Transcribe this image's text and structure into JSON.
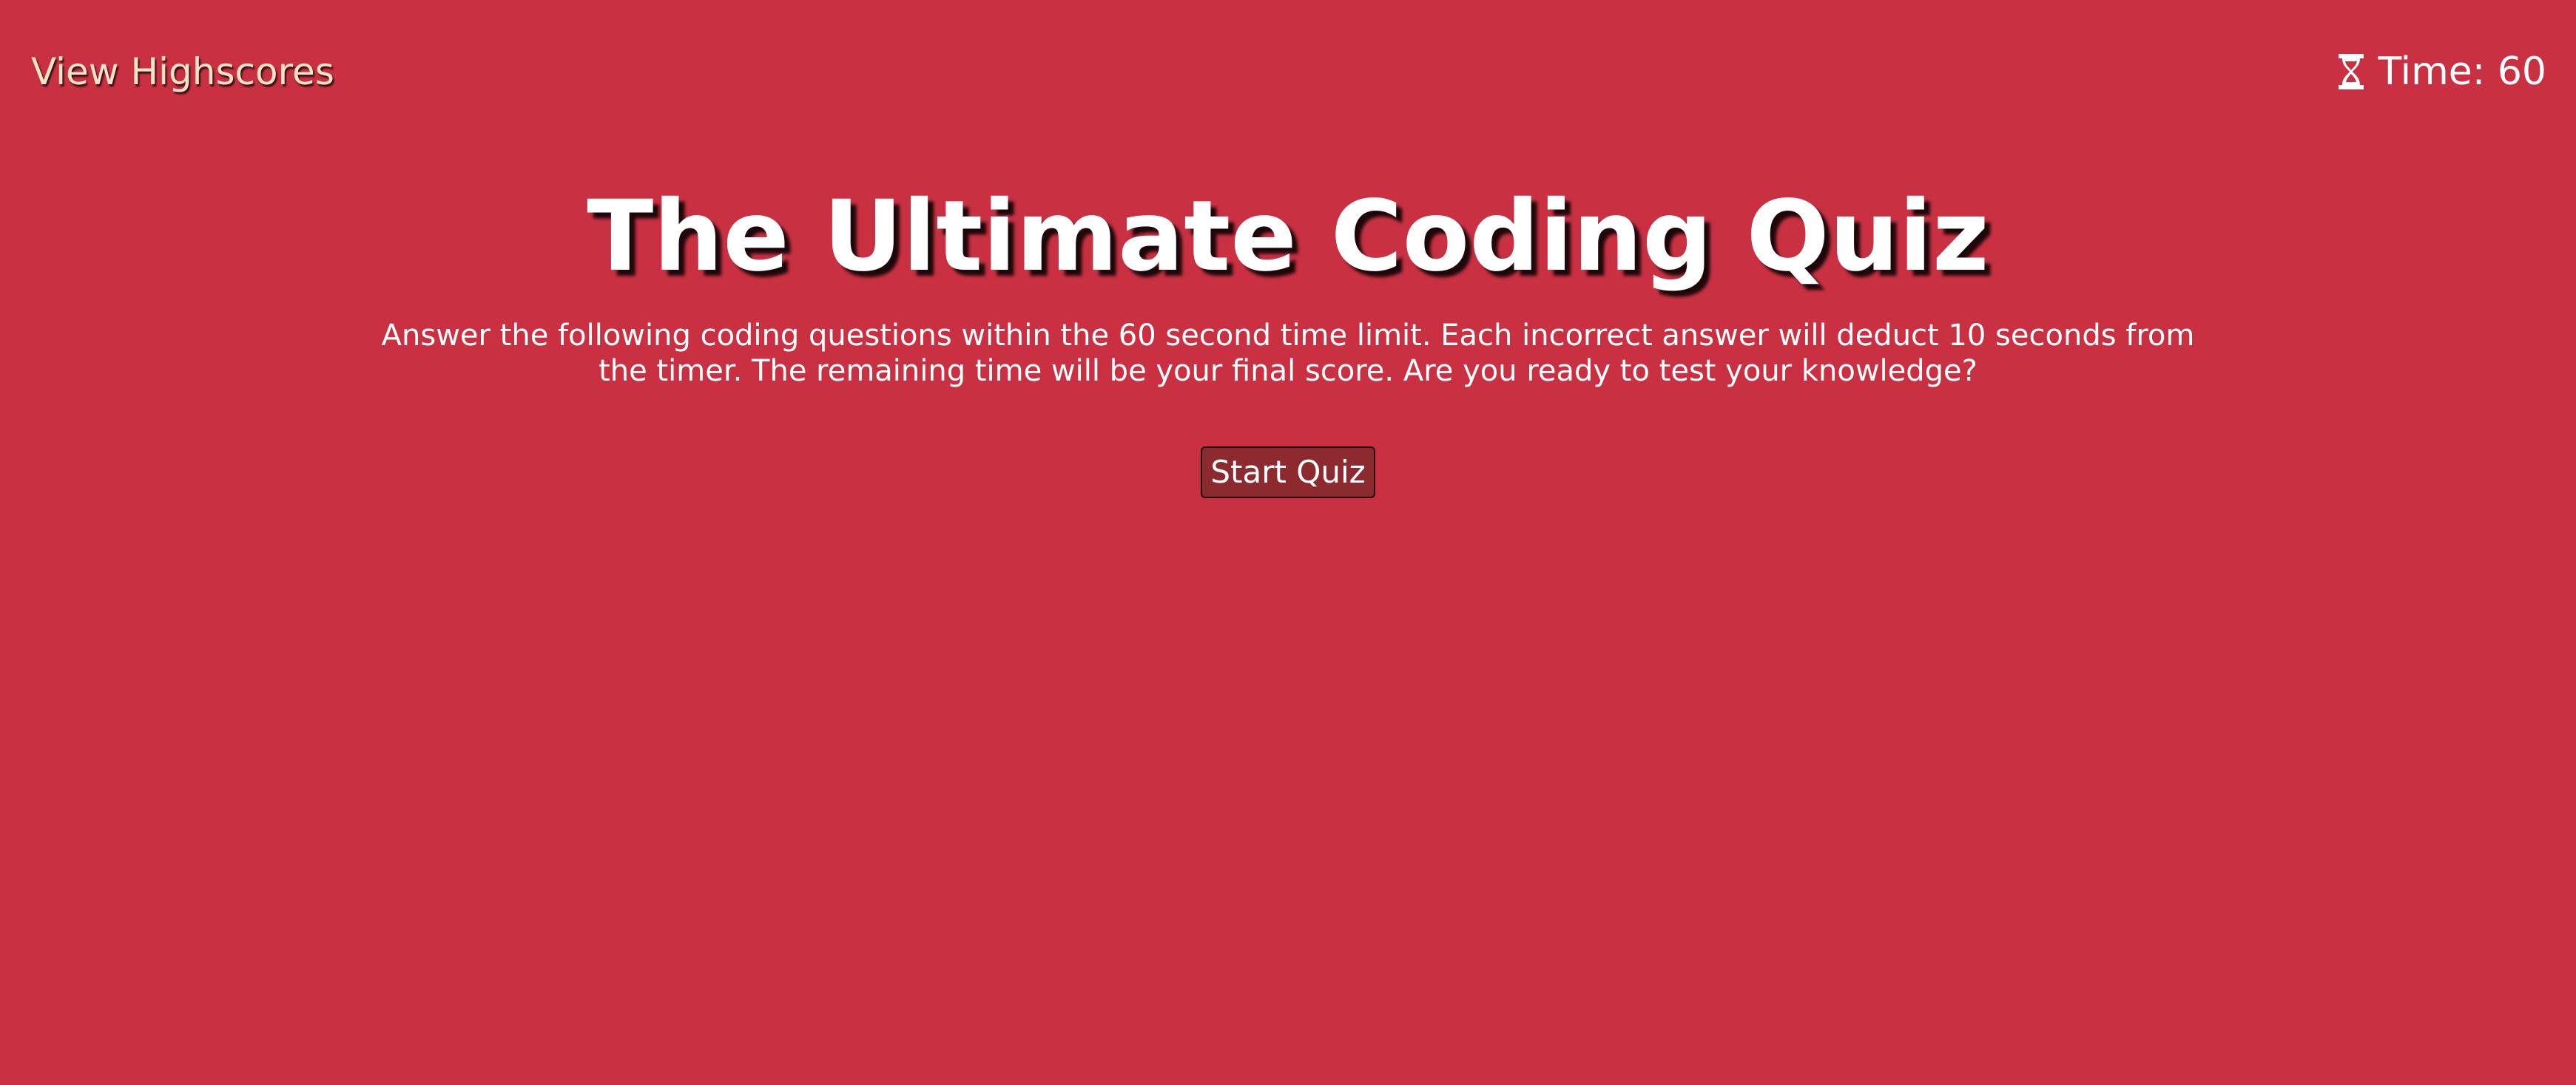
{
  "header": {
    "highscores_link": "View Highscores",
    "timer": {
      "icon": "hourglass-icon",
      "label": "Time: 60"
    }
  },
  "main": {
    "title": "The Ultimate Coding Quiz",
    "intro": "Answer the following coding questions within the 60 second time limit. Each incorrect answer will deduct 10 seconds from the timer. The remaining time will be your final score. Are you ready to test your knowledge?",
    "start_button": "Start Quiz"
  },
  "colors": {
    "background": "#c93142",
    "link_text": "#f6e2c7",
    "button_background": "#8d2a2f",
    "text": "#ffffff"
  }
}
